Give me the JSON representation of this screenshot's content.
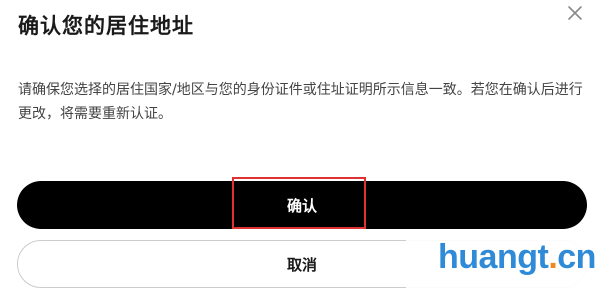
{
  "dialog": {
    "title": "确认您的居住地址",
    "close_icon": "close-icon",
    "description": "请确保您选择的居住国家/地区与您的身份证件或住址证明所示信息一致。若您在确认后进行更改，将需要重新认证。",
    "confirm_label": "确认",
    "cancel_label": "取消"
  },
  "watermark": {
    "main": "huangt",
    "dot": ".",
    "tld": "cn"
  },
  "colors": {
    "primary_button_bg": "#000000",
    "primary_button_text": "#ffffff",
    "highlight_border": "#e03232",
    "watermark_blue": "#2f8ad8",
    "watermark_orange": "#f2891d"
  }
}
